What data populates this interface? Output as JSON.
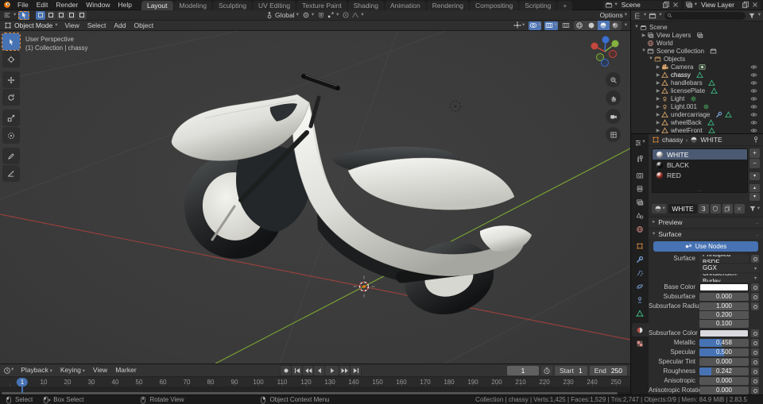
{
  "colors": {
    "accent": "#4772b3",
    "axis_x": "#a4423c",
    "axis_y": "#79a033",
    "active_tool_outline": "#e8913c"
  },
  "topbar": {
    "menus": [
      "File",
      "Edit",
      "Render",
      "Window",
      "Help"
    ],
    "tabs": [
      {
        "label": "Layout",
        "active": true
      },
      {
        "label": "Modeling"
      },
      {
        "label": "Sculpting"
      },
      {
        "label": "UV Editing"
      },
      {
        "label": "Texture Paint"
      },
      {
        "label": "Shading"
      },
      {
        "label": "Animation"
      },
      {
        "label": "Rendering"
      },
      {
        "label": "Compositing"
      },
      {
        "label": "Scripting"
      },
      {
        "label": "+"
      }
    ],
    "scene": {
      "label": "Scene"
    },
    "view_layer": {
      "label": "View Layer"
    }
  },
  "tool_settings": {
    "orientation": "Global",
    "options": "Options",
    "select_modes": [
      "set",
      "extend",
      "subtract",
      "invert",
      "intersect"
    ],
    "active_mode": 0
  },
  "viewport_header": {
    "mode": "Object Mode",
    "menus": [
      "View",
      "Select",
      "Add",
      "Object"
    ],
    "shading": [
      {
        "icon": "wire-sphere-icon",
        "name": "wireframe"
      },
      {
        "icon": "solid-sphere-icon",
        "name": "solid"
      },
      {
        "icon": "material-sphere-icon",
        "name": "material-preview",
        "active": true
      },
      {
        "icon": "rendered-sphere-icon",
        "name": "rendered"
      }
    ]
  },
  "viewport": {
    "overlay": [
      "User Perspective",
      "(1) Collection | chassy"
    ],
    "toolbar": [
      {
        "icon": "select-box-tool-icon",
        "name": "select-box",
        "active": true
      },
      {
        "icon": "cursor-tool-icon",
        "name": "cursor"
      },
      {
        "icon": "move-tool-icon",
        "name": "move"
      },
      {
        "icon": "rotate-tool-icon",
        "name": "rotate"
      },
      {
        "icon": "scale-tool-icon",
        "name": "scale"
      },
      {
        "icon": "transform-tool-icon",
        "name": "transform"
      },
      {
        "icon": "annotate-tool-icon",
        "name": "annotate"
      },
      {
        "icon": "measure-tool-icon",
        "name": "measure"
      }
    ],
    "nav_buttons": [
      {
        "icon": "zoom-icon",
        "name": "zoom"
      },
      {
        "icon": "hand-icon",
        "name": "pan"
      },
      {
        "icon": "camera-nav-icon",
        "name": "camera-view"
      },
      {
        "icon": "ortho-icon",
        "name": "toggle-perspective"
      }
    ]
  },
  "outliner": {
    "rows": [
      {
        "label": "Scene",
        "icon": "scene-icon",
        "indent": 0,
        "exp": "open"
      },
      {
        "label": "View Layers",
        "icon": "renderlayer-icon",
        "indent": 1,
        "exp": "closed",
        "extras": [
          "renderlayer-icon"
        ]
      },
      {
        "label": "World",
        "icon": "world-icon",
        "indent": 1
      },
      {
        "label": "Scene Collection",
        "icon": "collection-white-icon",
        "indent": 1,
        "exp": "open",
        "extras": [
          "collection-white-icon"
        ]
      },
      {
        "label": "Objects",
        "icon": "collection-icon",
        "indent": 2,
        "exp": "open"
      },
      {
        "label": "Camera",
        "icon": "camera-icon",
        "indent": 3,
        "exp": "closed",
        "extras": [
          "camera-data-icon"
        ],
        "eye": true
      },
      {
        "label": "chassy",
        "icon": "mesh-icon",
        "indent": 3,
        "exp": "closed",
        "extras": [
          "meshdata-icon"
        ],
        "eye": true,
        "active": true
      },
      {
        "label": "handlebars",
        "icon": "mesh-icon",
        "indent": 3,
        "exp": "closed",
        "extras": [
          "meshdata-icon"
        ],
        "eye": true
      },
      {
        "label": "licensePlate",
        "icon": "mesh-icon",
        "indent": 3,
        "exp": "closed",
        "extras": [
          "meshdata-icon"
        ],
        "eye": true
      },
      {
        "label": "Light",
        "icon": "light-icon",
        "indent": 3,
        "exp": "closed",
        "extras": [
          "lightdata-icon"
        ],
        "eye": true
      },
      {
        "label": "Light.001",
        "icon": "light-icon",
        "indent": 3,
        "exp": "closed",
        "extras": [
          "lightdata-icon"
        ],
        "eye": true
      },
      {
        "label": "undercarriage",
        "icon": "mesh-icon",
        "indent": 3,
        "exp": "closed",
        "extras": [
          "wrench-icon",
          "meshdata-icon"
        ],
        "eye": true
      },
      {
        "label": "wheelBack",
        "icon": "mesh-icon",
        "indent": 3,
        "exp": "closed",
        "extras": [
          "meshdata-icon"
        ],
        "eye": true
      },
      {
        "label": "wheelFront",
        "icon": "mesh-icon",
        "indent": 3,
        "exp": "closed",
        "extras": [
          "meshdata-icon"
        ],
        "eye": true
      }
    ]
  },
  "properties": {
    "tabs": [
      {
        "icon": "tool-tab-icon",
        "name": "tool"
      },
      {
        "icon": "render-tab-icon",
        "name": "render",
        "gap": true
      },
      {
        "icon": "output-tab-icon",
        "name": "output"
      },
      {
        "icon": "viewlayer-tab-icon",
        "name": "view-layer"
      },
      {
        "icon": "scene-tab-icon",
        "name": "scene"
      },
      {
        "icon": "world-tab-icon",
        "name": "world"
      },
      {
        "icon": "object-tab-icon",
        "name": "object",
        "gap": true
      },
      {
        "icon": "modifier-tab-icon",
        "name": "modifiers"
      },
      {
        "icon": "particles-tab-icon",
        "name": "particles"
      },
      {
        "icon": "physics-tab-icon",
        "name": "physics"
      },
      {
        "icon": "constraint-tab-icon",
        "name": "constraints"
      },
      {
        "icon": "data-tab-icon",
        "name": "object-data"
      },
      {
        "icon": "material-tab-icon",
        "name": "material",
        "active": true,
        "gap": true
      },
      {
        "icon": "texture-tab-icon",
        "name": "texture"
      }
    ],
    "breadcrumb": {
      "object": "chassy",
      "separator": "›",
      "material": "WHITE"
    },
    "slots": [
      {
        "name": "WHITE",
        "swatch": "#e2e2e2",
        "selected": true
      },
      {
        "name": "BLACK",
        "swatch": "#141414"
      },
      {
        "name": "RED",
        "swatch": "#c0392b"
      }
    ],
    "datablock": {
      "name": "WHITE",
      "users": "3"
    },
    "panels": {
      "preview": "Preview",
      "surface": "Surface"
    },
    "use_nodes": "Use Nodes",
    "fields": [
      {
        "label": "Surface",
        "type": "menu-dot",
        "value": "Principled BSDF"
      },
      {
        "label": "",
        "type": "menu",
        "value": "GGX"
      },
      {
        "label": "",
        "type": "menu",
        "value": "Christensen-Burley"
      },
      {
        "label": "Base Color",
        "type": "color",
        "value": "#ffffff"
      },
      {
        "label": "Subsurface",
        "type": "slider",
        "value": "0.000",
        "fill": 0
      },
      {
        "label": "Subsurface Radius",
        "type": "vector",
        "values": [
          "1.000",
          "0.200",
          "0.100"
        ]
      },
      {
        "label": "Subsurface Color",
        "type": "color",
        "value": "#d9d9de"
      },
      {
        "label": "Metallic",
        "type": "slider",
        "value": "0.458",
        "fill": 0.458
      },
      {
        "label": "Specular",
        "type": "slider",
        "value": "0.500",
        "fill": 0.5
      },
      {
        "label": "Specular Tint",
        "type": "slider",
        "value": "0.000",
        "fill": 0
      },
      {
        "label": "Roughness",
        "type": "slider",
        "value": "0.242",
        "fill": 0.242
      },
      {
        "label": "Anisotropic",
        "type": "slider",
        "value": "0.000",
        "fill": 0
      },
      {
        "label": "Anisotropic Rotation",
        "type": "slider",
        "value": "0.000",
        "fill": 0
      }
    ]
  },
  "timeline": {
    "menus": [
      {
        "label": "Playback",
        "caret": true
      },
      {
        "label": "Keying",
        "caret": true
      },
      {
        "label": "View"
      },
      {
        "label": "Marker"
      }
    ],
    "playback": [
      "record",
      "jump-to-start",
      "previous-keyframe",
      "previous-frame",
      "play",
      "next-keyframe",
      "jump-to-end"
    ],
    "current_frame": "1",
    "start_label": "Start",
    "start": "1",
    "end_label": "End",
    "end": "250",
    "first_tick": "1",
    "ticks": [
      10,
      20,
      30,
      40,
      50,
      60,
      70,
      80,
      90,
      100,
      110,
      120,
      130,
      140,
      150,
      160,
      170,
      180,
      190,
      200,
      210,
      220,
      230,
      240,
      250
    ]
  },
  "statusbar": {
    "hints": [
      {
        "icon": "mouse-left-icon",
        "label": "Select"
      },
      {
        "icon": "mouse-left-drag-icon",
        "label": "Box Select"
      },
      {
        "icon": "mouse-middle-icon",
        "label": "Rotate View"
      },
      {
        "icon": "mouse-right-icon",
        "label": "Object Context Menu"
      }
    ],
    "stats": "Collection | chassy | Verts:1,425 | Faces:1,529 | Tris:2,747 | Objects:0/9 | Mem: 84.9 MiB | 2.83.5"
  }
}
